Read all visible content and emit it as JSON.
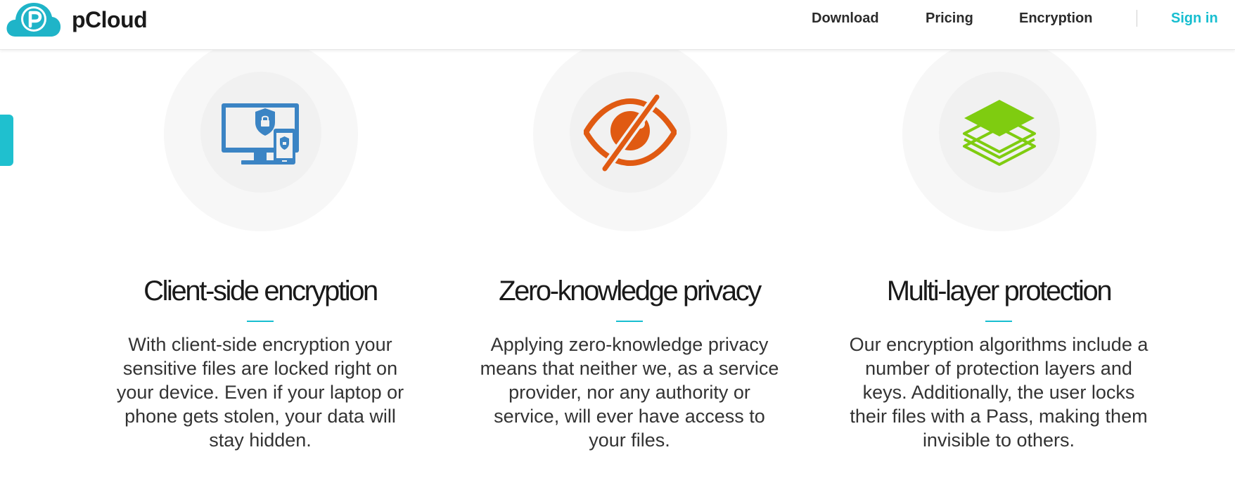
{
  "header": {
    "brand": "pCloud",
    "nav": {
      "download": "Download",
      "pricing": "Pricing",
      "encryption": "Encryption",
      "sign_in": "Sign in"
    }
  },
  "features": [
    {
      "icon": "devices-shield-icon",
      "title": "Client-side encryption",
      "text": "With client-side encryption your sensitive files are locked right on your device. Even if your laptop or phone gets stolen, your data will stay hidden."
    },
    {
      "icon": "eye-slash-icon",
      "title": "Zero-knowledge privacy",
      "text": "Applying zero-knowledge privacy means that neither we, as a service provider, nor any authority or service, will ever have access to your files."
    },
    {
      "icon": "layers-icon",
      "title": "Multi-layer protection",
      "text": "Our encryption algorithms include a number of protection layers and keys. Additionally, the user locks their files with a Pass, making them invisible to others."
    }
  ],
  "colors": {
    "accent": "#17bed0",
    "side_tab": "#1fc0cf",
    "devices_blue": "#3b84c4",
    "eye_orange": "#e05a12",
    "layers_green": "#7fcc10"
  }
}
